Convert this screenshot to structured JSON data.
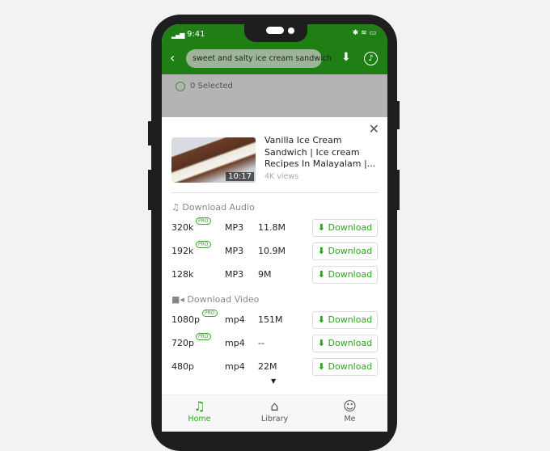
{
  "status": {
    "time": "9:41"
  },
  "header": {
    "search_value": "sweet and salty ice cream sandwich"
  },
  "selection": {
    "label": "0 Selected"
  },
  "video": {
    "title": "Vanilla Ice Cream Sandwich | Ice cream Recipes In Malayalam |...",
    "duration": "10:17",
    "views": "4K views"
  },
  "audio": {
    "heading": "Download Audio",
    "rows": [
      {
        "quality": "320k",
        "pro": "PRO",
        "format": "MP3",
        "size": "11.8M",
        "button": "Download"
      },
      {
        "quality": "192k",
        "pro": "PRO",
        "format": "MP3",
        "size": "10.9M",
        "button": "Download"
      },
      {
        "quality": "128k",
        "pro": "",
        "format": "MP3",
        "size": "9M",
        "button": "Download"
      }
    ]
  },
  "videos": {
    "heading": "Download Video",
    "rows": [
      {
        "quality": "1080p",
        "pro": "PRO",
        "format": "mp4",
        "size": "151M",
        "button": "Download"
      },
      {
        "quality": "720p",
        "pro": "PRO",
        "format": "mp4",
        "size": "--",
        "button": "Download"
      },
      {
        "quality": "480p",
        "pro": "",
        "format": "mp4",
        "size": "22M",
        "button": "Download"
      }
    ]
  },
  "nav": [
    {
      "label": "Home",
      "active": true
    },
    {
      "label": "Library"
    },
    {
      "label": "Me"
    }
  ],
  "colors": {
    "brand": "#1f7f15",
    "accent": "#2ea41f"
  }
}
